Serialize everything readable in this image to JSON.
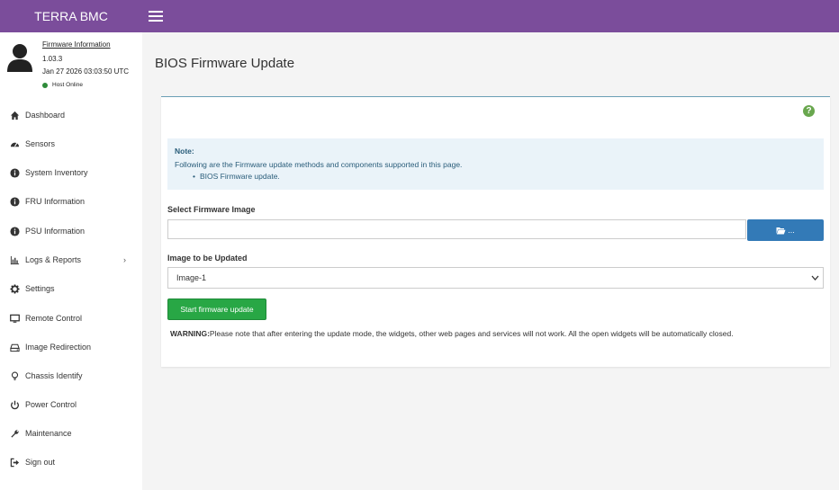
{
  "app": {
    "brand": "TERRA BMC"
  },
  "user": {
    "title": "Firmware Information",
    "version": "1.03.3",
    "datetime": "Jan 27 2026 03:03:50 UTC",
    "host_status": "Host Online",
    "host_status_color": "#2e8b3a"
  },
  "sidebar": {
    "items": [
      {
        "label": "Dashboard",
        "icon": "home-icon"
      },
      {
        "label": "Sensors",
        "icon": "dashboard-gauge-icon"
      },
      {
        "label": "System Inventory",
        "icon": "info-circle-icon"
      },
      {
        "label": "FRU Information",
        "icon": "info-circle-icon"
      },
      {
        "label": "PSU Information",
        "icon": "info-circle-icon"
      },
      {
        "label": "Logs & Reports",
        "icon": "bar-chart-icon",
        "has_submenu": true
      },
      {
        "label": "Settings",
        "icon": "gear-icon"
      },
      {
        "label": "Remote Control",
        "icon": "monitor-icon"
      },
      {
        "label": "Image Redirection",
        "icon": "drive-icon"
      },
      {
        "label": "Chassis Identify",
        "icon": "lightbulb-icon"
      },
      {
        "label": "Power Control",
        "icon": "power-icon"
      },
      {
        "label": "Maintenance",
        "icon": "wrench-icon"
      },
      {
        "label": "Sign out",
        "icon": "sign-out-icon"
      }
    ]
  },
  "main": {
    "page_title": "BIOS Firmware Update",
    "note": {
      "title": "Note:",
      "line": "Following are the Firmware update methods and components supported in this page.",
      "bullet": "BIOS Firmware update."
    },
    "select_image_label": "Select Firmware Image",
    "browse_label": "...",
    "image_to_update_label": "Image to be Updated",
    "image_selected": "Image-1",
    "start_button": "Start firmware update",
    "warning_label": "WARNING:",
    "warning_text": "Please note that after entering the update mode, the widgets, other web pages and services will not work. All the open widgets will be automatically closed."
  },
  "colors": {
    "topbar": "#7b4d9b",
    "primary_button": "#337ab7",
    "success_button": "#28a745",
    "help_icon": "#69a74e",
    "note_bg": "#eaf3f9"
  }
}
